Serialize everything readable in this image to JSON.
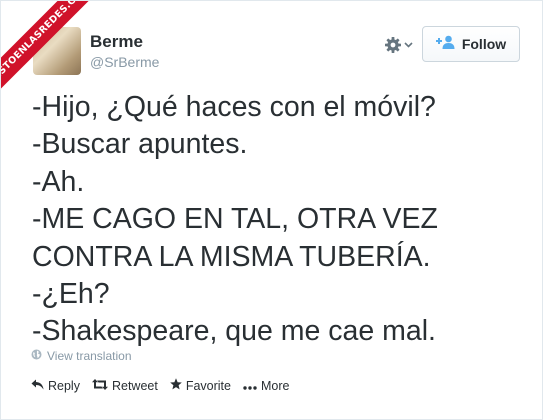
{
  "watermark": {
    "text": "VISTOENLASREDES.COM"
  },
  "user": {
    "name": "Berme",
    "handle": "@SrBerme"
  },
  "header": {
    "follow_label": "Follow",
    "settings_icon": "gear-icon",
    "follow_icon": "add-user-icon"
  },
  "tweet": {
    "lines": [
      "-Hijo, ¿Qué haces con el móvil?",
      "-Buscar apuntes.",
      "-Ah.",
      "-ME CAGO EN TAL, OTRA VEZ",
      "CONTRA LA MISMA TUBERÍA.",
      "-¿Eh?",
      "-Shakespeare, que me cae mal."
    ],
    "translation_label": "View translation"
  },
  "actions": {
    "reply_label": "Reply",
    "retweet_label": "Retweet",
    "favorite_label": "Favorite",
    "more_label": "More"
  },
  "colors": {
    "accent": "#55acee",
    "muted": "#8899a6",
    "text": "#292f33",
    "ribbon": "#d0122a"
  }
}
